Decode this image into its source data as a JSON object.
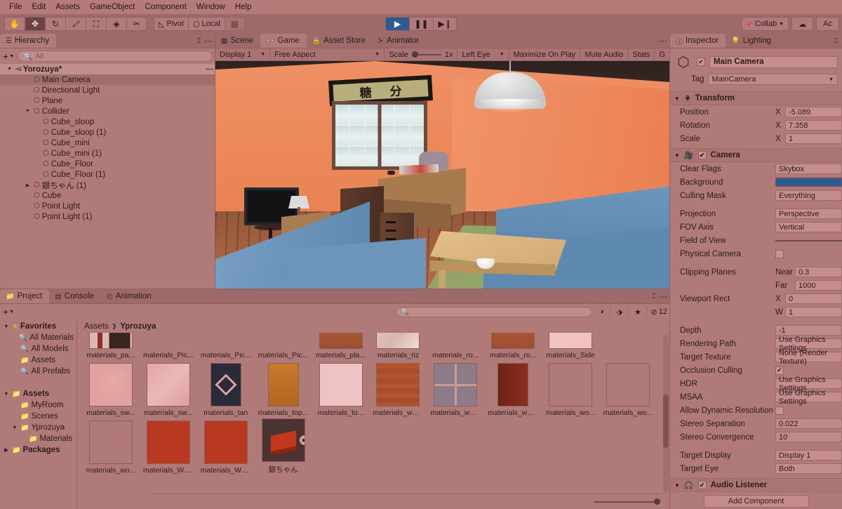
{
  "menubar": {
    "items": [
      "File",
      "Edit",
      "Assets",
      "GameObject",
      "Component",
      "Window",
      "Help"
    ]
  },
  "toolbar": {
    "tools": [
      {
        "name": "hand-tool",
        "glyph": "✋",
        "active": false
      },
      {
        "name": "move-tool",
        "glyph": "✥",
        "active": true
      },
      {
        "name": "rotate-tool",
        "glyph": "↻",
        "active": false
      },
      {
        "name": "scale-tool",
        "glyph": "⤢",
        "active": false
      },
      {
        "name": "rect-tool",
        "glyph": "⛶",
        "active": false
      },
      {
        "name": "transform-tool",
        "glyph": "◈",
        "active": false
      },
      {
        "name": "custom-tool",
        "glyph": "✂",
        "active": false
      }
    ],
    "pivot_label": "Pivot",
    "handle_label": "Local",
    "grid_glyph": "▦",
    "play_glyph": "▶",
    "pause_glyph": "❚❚",
    "step_glyph": "▶❙",
    "playing": true,
    "collab_label": "Collab",
    "cloud_glyph": "☁",
    "account_label": "Ac",
    "accent_play": "#2c5c92"
  },
  "hierarchy": {
    "tabs": [
      {
        "label": "Hierarchy",
        "icon": "hierarchy-icon",
        "active": true
      }
    ],
    "lock_glyph": "🔒",
    "add_label": "+",
    "search_placeholder": "All",
    "items": [
      {
        "label": "Yorozuya*",
        "depth": 0,
        "arrow": "▼",
        "icon": "scene-icon",
        "root": true,
        "selected": false
      },
      {
        "label": "Main Camera",
        "depth": 2,
        "arrow": "",
        "icon": "gameobject-icon",
        "selected": true
      },
      {
        "label": "Directional Light",
        "depth": 2,
        "arrow": "",
        "icon": "gameobject-icon",
        "selected": false
      },
      {
        "label": "Plane",
        "depth": 2,
        "arrow": "",
        "icon": "gameobject-icon",
        "selected": false
      },
      {
        "label": "Collider",
        "depth": 2,
        "arrow": "▼",
        "icon": "gameobject-icon",
        "selected": false
      },
      {
        "label": "Cube_sloop",
        "depth": 3,
        "arrow": "",
        "icon": "gameobject-icon",
        "selected": false
      },
      {
        "label": "Cube_sloop (1)",
        "depth": 3,
        "arrow": "",
        "icon": "gameobject-icon",
        "selected": false
      },
      {
        "label": "Cube_mini",
        "depth": 3,
        "arrow": "",
        "icon": "gameobject-icon",
        "selected": false
      },
      {
        "label": "Cube_mini (1)",
        "depth": 3,
        "arrow": "",
        "icon": "gameobject-icon",
        "selected": false
      },
      {
        "label": "Cube_Floor",
        "depth": 3,
        "arrow": "",
        "icon": "gameobject-icon",
        "selected": false
      },
      {
        "label": "Cube_Floor (1)",
        "depth": 3,
        "arrow": "",
        "icon": "gameobject-icon",
        "selected": false
      },
      {
        "label": "銀ちゃん (1)",
        "depth": 2,
        "arrow": "▶",
        "icon": "gameobject-icon",
        "selected": false
      },
      {
        "label": "Cube",
        "depth": 2,
        "arrow": "",
        "icon": "gameobject-icon",
        "selected": false
      },
      {
        "label": "Point Light",
        "depth": 2,
        "arrow": "",
        "icon": "gameobject-icon",
        "selected": false
      },
      {
        "label": "Point Light (1)",
        "depth": 2,
        "arrow": "",
        "icon": "gameobject-icon",
        "selected": false
      }
    ]
  },
  "gameview": {
    "tabs": [
      {
        "label": "Scene",
        "icon": "grid-icon",
        "active": false
      },
      {
        "label": "Game",
        "icon": "gamepad-icon",
        "active": true
      },
      {
        "label": "Asset Store",
        "icon": "store-icon",
        "active": false
      },
      {
        "label": "Animator",
        "icon": "animator-icon",
        "active": false
      }
    ],
    "display": "Display 1",
    "aspect": "Free Aspect",
    "scale_label": "Scale",
    "scale_value": "1x",
    "eye": "Left Eye",
    "maximize": "Maximize On Play",
    "mute": "Mute Audio",
    "stats": "Stats",
    "gizmos": "G",
    "scene": {
      "sign_chars": [
        "糖",
        "分"
      ],
      "wall_color": "#ea8355",
      "sofa_color": "#6a92b8",
      "floor_color": "#a55c36",
      "rug_color": "#8fa96b"
    }
  },
  "project": {
    "tabs": [
      {
        "label": "Project",
        "icon": "folder-icon",
        "active": true
      },
      {
        "label": "Console",
        "icon": "console-icon",
        "active": false
      },
      {
        "label": "Animation",
        "icon": "clock-icon",
        "active": false
      }
    ],
    "add_label": "+",
    "search_placeholder": "",
    "filter_icons": [
      "type-filter-icon",
      "label-filter-icon",
      "favorite-filter-icon"
    ],
    "visibility_count": "12",
    "breadcrumb": [
      "Assets",
      "Yprozuya"
    ],
    "tree": [
      {
        "label": "Favorites",
        "depth": 0,
        "arrow": "▼",
        "icon": "star-icon",
        "bold": true
      },
      {
        "label": "All Materials",
        "depth": 1,
        "arrow": "",
        "icon": "search-icon",
        "bold": false
      },
      {
        "label": "All Models",
        "depth": 1,
        "arrow": "",
        "icon": "search-icon",
        "bold": false
      },
      {
        "label": "Assets",
        "depth": 1,
        "arrow": "",
        "icon": "folder-fav-icon",
        "bold": false
      },
      {
        "label": "All Prefabs",
        "depth": 1,
        "arrow": "",
        "icon": "search-icon",
        "bold": false
      },
      {
        "label": "",
        "depth": 0,
        "arrow": "",
        "icon": "",
        "bold": false
      },
      {
        "label": "Assets",
        "depth": 0,
        "arrow": "▼",
        "icon": "folder-icon",
        "bold": true
      },
      {
        "label": "MyRoom",
        "depth": 1,
        "arrow": "",
        "icon": "folder-icon",
        "bold": false
      },
      {
        "label": "Scenes",
        "depth": 1,
        "arrow": "",
        "icon": "folder-open-icon",
        "bold": false
      },
      {
        "label": "Yprozuya",
        "depth": 1,
        "arrow": "▼",
        "icon": "folder-open-icon",
        "bold": false
      },
      {
        "label": "Materials",
        "depth": 2,
        "arrow": "",
        "icon": "folder-icon",
        "bold": false
      },
      {
        "label": "Packages",
        "depth": 0,
        "arrow": "▶",
        "icon": "folder-icon",
        "bold": true
      }
    ],
    "assets": [
      {
        "label": "materials_pa...",
        "style": "picture-strip",
        "tall": false
      },
      {
        "label": "materials_Pic...",
        "style": "blank",
        "tall": false
      },
      {
        "label": "materials_Pic...",
        "style": "blank",
        "tall": false
      },
      {
        "label": "materials_Pic...",
        "style": "blank",
        "tall": false
      },
      {
        "label": "materials_pla...",
        "style": "wood-dark",
        "tall": false
      },
      {
        "label": "materials_riz",
        "style": "marble",
        "tall": false
      },
      {
        "label": "materials_ro...",
        "style": "blank",
        "tall": false
      },
      {
        "label": "materials_ro...",
        "style": "wood-red",
        "tall": false
      },
      {
        "label": "materials_Side",
        "style": "pale-pink",
        "tall": false
      },
      {
        "label": "",
        "style": "blank",
        "tall": false
      },
      {
        "label": "materials_sw...",
        "style": "pink-soft",
        "tall": false
      },
      {
        "label": "materials_sw...",
        "style": "pink-diag",
        "tall": false
      },
      {
        "label": "materials_tan",
        "style": "noren",
        "tall": true
      },
      {
        "label": "materials_top...",
        "style": "orange-flat",
        "tall": true
      },
      {
        "label": "materials_to...",
        "style": "pink-plain",
        "tall": false
      },
      {
        "label": "materials_wall...",
        "style": "wood-floor-red",
        "tall": false
      },
      {
        "label": "materials_wall...",
        "style": "tile-grey",
        "tall": false
      },
      {
        "label": "materials_wall...",
        "style": "wood-deep",
        "tall": true
      },
      {
        "label": "materials_wo...",
        "style": "wood-light",
        "tall": false
      },
      {
        "label": "materials_wo...",
        "style": "wood-light",
        "tall": false
      },
      {
        "label": "materials_wo...",
        "style": "wood-light",
        "tall": false
      },
      {
        "label": "materials_Wo...",
        "style": "wood-rough",
        "tall": false
      },
      {
        "label": "materials_Wo...",
        "style": "wood-rough",
        "tall": false
      },
      {
        "label": "銀ちゃん",
        "style": "prefab-model",
        "tall": false
      }
    ]
  },
  "inspector": {
    "tabs": [
      {
        "label": "Inspector",
        "icon": "info-icon",
        "active": true
      },
      {
        "label": "Lighting",
        "icon": "bulb-icon",
        "active": false
      }
    ],
    "object_name": "Main Camera",
    "object_enabled": true,
    "tag_label": "Tag",
    "tag_value": "MainCamera",
    "components": [
      {
        "name": "Transform",
        "icon": "axis-icon",
        "has_checkbox": false,
        "props": [
          {
            "label": "Position",
            "axis": "X",
            "value": "-5.089",
            "type": "field"
          },
          {
            "label": "Rotation",
            "axis": "X",
            "value": "7.358",
            "type": "field"
          },
          {
            "label": "Scale",
            "axis": "X",
            "value": "1",
            "type": "field"
          }
        ]
      },
      {
        "name": "Camera",
        "icon": "camera-icon",
        "has_checkbox": true,
        "checked": true,
        "props": [
          {
            "label": "Clear Flags",
            "value": "Skybox",
            "type": "dropdown"
          },
          {
            "label": "Background",
            "value": "",
            "type": "color",
            "color": "#2d5a8e"
          },
          {
            "label": "Culling Mask",
            "value": "Everything",
            "type": "dropdown"
          },
          {
            "label": "",
            "value": "",
            "type": "spacer"
          },
          {
            "label": "Projection",
            "value": "Perspective",
            "type": "dropdown"
          },
          {
            "label": "FOV Axis",
            "value": "Vertical",
            "type": "dropdown"
          },
          {
            "label": "Field of View",
            "value": "",
            "type": "slider"
          },
          {
            "label": "Physical Camera",
            "value": "",
            "type": "checkbox",
            "checked": false
          },
          {
            "label": "",
            "value": "",
            "type": "spacer"
          },
          {
            "label": "Clipping Planes",
            "axis": "Near",
            "value": "0.3",
            "type": "field"
          },
          {
            "label": "",
            "axis": "Far",
            "value": "1000",
            "type": "field"
          },
          {
            "label": "Viewport Rect",
            "axis": "X",
            "value": "0",
            "type": "field"
          },
          {
            "label": "",
            "axis": "W",
            "value": "1",
            "type": "field"
          },
          {
            "label": "",
            "value": "",
            "type": "spacer"
          },
          {
            "label": "Depth",
            "value": "-1",
            "type": "flatfield"
          },
          {
            "label": "Rendering Path",
            "value": "Use Graphics Settings",
            "type": "dropdown"
          },
          {
            "label": "Target Texture",
            "value": "None (Render Texture)",
            "type": "dropdown"
          },
          {
            "label": "Occlusion Culling",
            "value": "",
            "type": "checkbox",
            "checked": true
          },
          {
            "label": "HDR",
            "value": "Use Graphics Settings",
            "type": "dropdown"
          },
          {
            "label": "MSAA",
            "value": "Use Graphics Settings",
            "type": "dropdown"
          },
          {
            "label": "Allow Dynamic Resolution",
            "value": "",
            "type": "checkbox",
            "checked": false
          },
          {
            "label": "Stereo Separation",
            "value": "0.022",
            "type": "flatfield"
          },
          {
            "label": "Stereo Convergence",
            "value": "10",
            "type": "flatfield"
          },
          {
            "label": "",
            "value": "",
            "type": "spacer"
          },
          {
            "label": "Target Display",
            "value": "Display 1",
            "type": "dropdown"
          },
          {
            "label": "Target Eye",
            "value": "Both",
            "type": "dropdown"
          }
        ]
      },
      {
        "name": "Audio Listener",
        "icon": "headphones-icon",
        "has_checkbox": true,
        "checked": true,
        "props": []
      }
    ],
    "add_component_label": "Add Component"
  }
}
